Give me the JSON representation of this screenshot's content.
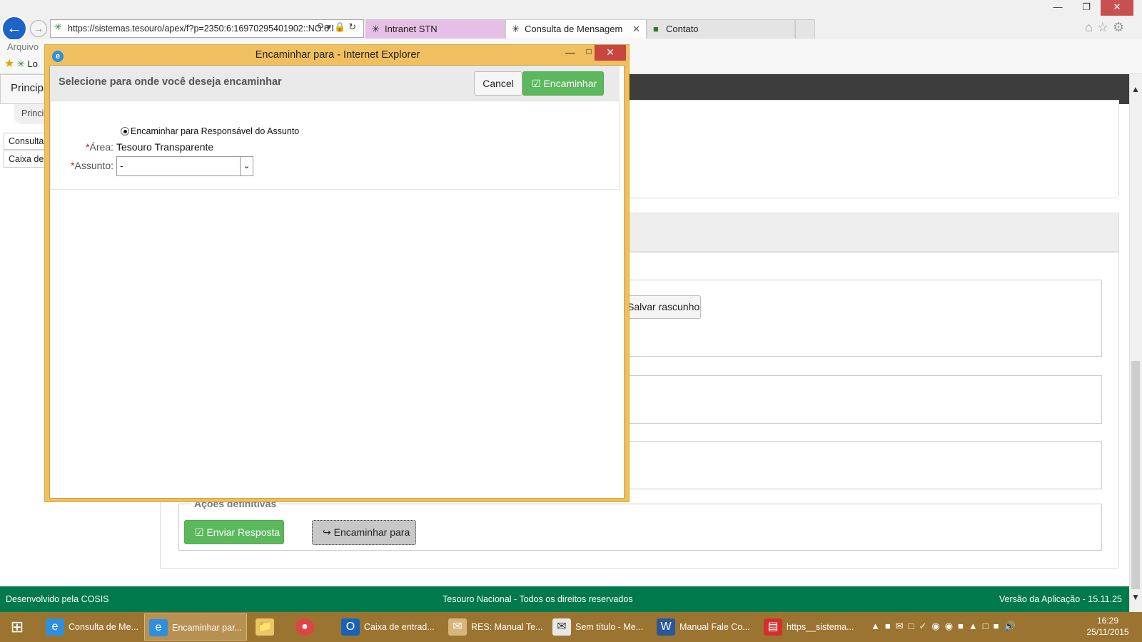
{
  "browser": {
    "url": "https://sistemas.tesouro/apex/f?p=2350:6:16970295401902::NO:6:I",
    "tabs": [
      {
        "label": "Intranet STN"
      },
      {
        "label": "Consulta de Mensagem"
      },
      {
        "label": "Contato"
      }
    ],
    "menu": "Arquivo",
    "favorites_item": "Lo"
  },
  "page": {
    "nav_home": "Principal",
    "breadcrumb": "Princip",
    "side_links": [
      "Consultar",
      "Caixa de"
    ],
    "salvar_label": "Salvar rascunho",
    "acoes_legend": "Ações definitivas",
    "enviar_label": "Enviar Resposta",
    "encaminhar_label": "Encaminhar para",
    "footer_left": "Desenvolvido pela COSIS",
    "footer_center": "Tesouro Nacional - Todos os direitos reservados",
    "footer_right": "Versão da Aplicação - 15.11.25"
  },
  "dialog": {
    "title": "Encaminhar para - Internet Explorer",
    "header": "Selecione para onde você deseja encaminhar",
    "cancel_label": "Cancel",
    "ok_label": "Encaminhar",
    "radio_label": "Encaminhar para Responsável do Assunto",
    "area_label": "Área:",
    "area_value": "Tesouro Transparente",
    "assunto_label": "Assunto:",
    "assunto_value": "-"
  },
  "taskbar": {
    "items": [
      "Consulta de Me...",
      "Encaminhar par...",
      "",
      "",
      "Caixa de entrad...",
      "RES: Manual Te...",
      "Sem título - Me...",
      "Manual Fale Co...",
      "https__sistema..."
    ],
    "time": "16:29",
    "date": "25/11/2015"
  },
  "colors": {
    "accent_green": "#5cb85c",
    "footer_green": "#007a4d",
    "dialog_frame": "#f0c060",
    "taskbar": "#9c7431"
  }
}
